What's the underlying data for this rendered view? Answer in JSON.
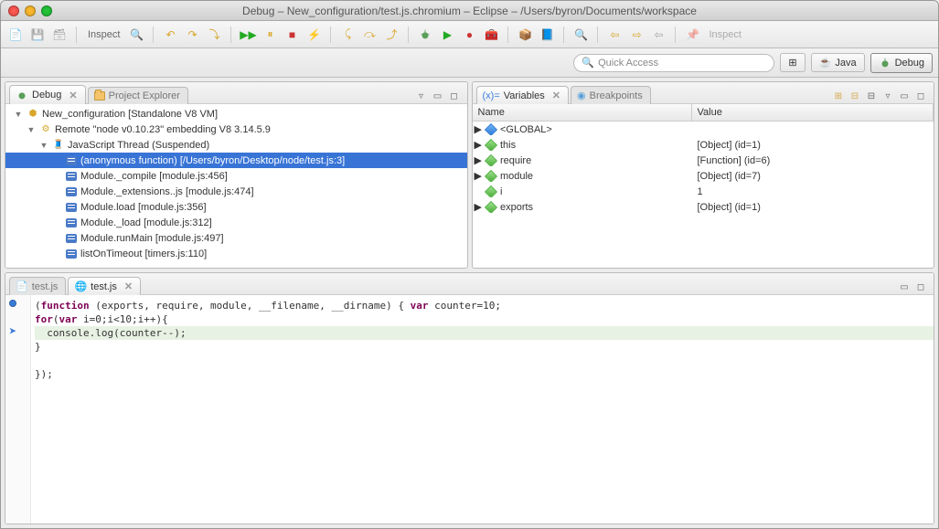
{
  "window": {
    "title": "Debug – New_configuration/test.js.chromium – Eclipse – /Users/byron/Documents/workspace"
  },
  "toolbar": {
    "inspect": "Inspect"
  },
  "quickaccess": {
    "placeholder": "Quick Access"
  },
  "perspectives": {
    "java": "Java",
    "debug": "Debug"
  },
  "debug_tab": {
    "label": "Debug"
  },
  "project_explorer_tab": {
    "label": "Project Explorer"
  },
  "debug_tree": {
    "config": "New_configuration [Standalone V8 VM]",
    "remote": "Remote \"node v0.10.23\" embedding V8 3.14.5.9",
    "thread": "JavaScript Thread (Suspended)",
    "frames": [
      "(anonymous function) [/Users/byron/Desktop/node/test.js:3]",
      "Module._compile [module.js:456]",
      "Module._extensions..js [module.js:474]",
      "Module.load [module.js:356]",
      "Module._load [module.js:312]",
      "Module.runMain [module.js:497]",
      "listOnTimeout [timers.js:110]"
    ]
  },
  "variables_tab": {
    "label": "Variables"
  },
  "breakpoints_tab": {
    "label": "Breakpoints"
  },
  "vars_header": {
    "name": "Name",
    "value": "Value"
  },
  "vars": [
    {
      "name": "<GLOBAL>",
      "value": "",
      "expandable": true,
      "green": false
    },
    {
      "name": "this",
      "value": "[Object]  (id=1)",
      "expandable": true,
      "green": true
    },
    {
      "name": "require",
      "value": "[Function]  (id=6)",
      "expandable": true,
      "green": true
    },
    {
      "name": "module",
      "value": "[Object]  (id=7)",
      "expandable": true,
      "green": true
    },
    {
      "name": "i",
      "value": "1",
      "expandable": false,
      "green": true
    },
    {
      "name": "exports",
      "value": "[Object]  (id=1)",
      "expandable": true,
      "green": true
    }
  ],
  "editor_tabs": {
    "inactive": "test.js",
    "active": "test.js"
  },
  "code": {
    "l1a": "(",
    "l1b": "function",
    "l1c": " (exports, require, module, __filename, __dirname) { ",
    "l1d": "var",
    "l1e": " counter=10;",
    "l2a": "for",
    "l2b": "(",
    "l2c": "var",
    "l2d": " i=0;i<10;i++){",
    "l3": "  console.log(counter--);",
    "l4": "}",
    "l5": "",
    "l6": "});"
  }
}
